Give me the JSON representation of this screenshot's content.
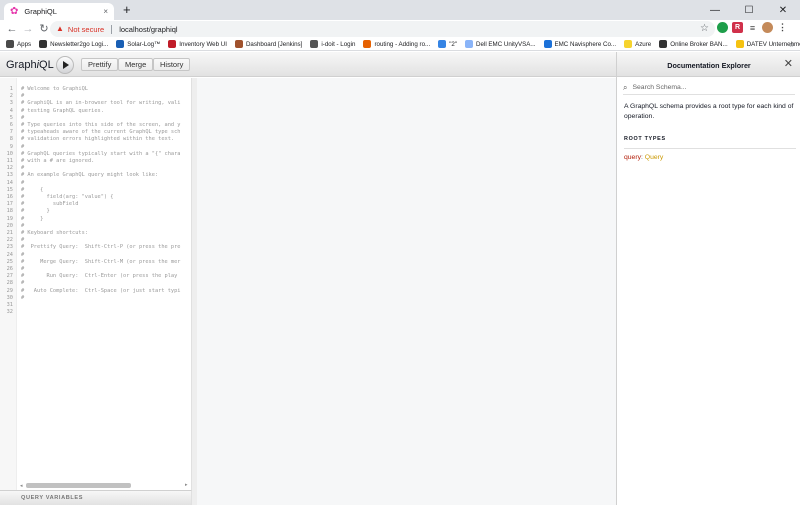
{
  "browser": {
    "tab_title": "GraphiQL",
    "tab_close": "×",
    "new_tab": "+",
    "window_controls": [
      "—",
      "☐",
      "✕"
    ],
    "nav": {
      "back": "←",
      "forward": "→",
      "reload": "↻"
    },
    "security_label": "Not secure",
    "url": "localhost/graphiql",
    "star_icon": "star-icon",
    "bookmarks": [
      {
        "label": "Apps",
        "color": "#4a4a4a"
      },
      {
        "label": "Newsletter2go Logi...",
        "color": "#333333"
      },
      {
        "label": "Solar-Log™",
        "color": "#1a5fb4"
      },
      {
        "label": "Inventory Web UI",
        "color": "#c01c28"
      },
      {
        "label": "Dashboard [Jenkins]",
        "color": "#a0522d"
      },
      {
        "label": "i-doit - Login",
        "color": "#555555"
      },
      {
        "label": "routing - Adding ro...",
        "color": "#e66100"
      },
      {
        "label": "\"2\"",
        "color": "#3584e4"
      },
      {
        "label": "Dell EMC UnityVSA...",
        "color": "#8ab4f8"
      },
      {
        "label": "EMC Navisphere Co...",
        "color": "#1c71d8"
      },
      {
        "label": "Azure",
        "color": "#f6d32d"
      },
      {
        "label": "Online Broker BAN...",
        "color": "#333333"
      },
      {
        "label": "DATEV Unternehme...",
        "color": "#f5c211"
      }
    ],
    "bookmarks_more": "»"
  },
  "graphiql": {
    "title_prefix": "Graph",
    "title_italic": "i",
    "title_suffix": "QL",
    "buttons": {
      "prettify": "Prettify",
      "merge": "Merge",
      "history": "History"
    },
    "editor_lines": [
      "# Welcome to GraphiQL",
      "#",
      "# GraphiQL is an in-browser tool for writing, vali",
      "# testing GraphQL queries.",
      "#",
      "# Type queries into this side of the screen, and y",
      "# typeaheads aware of the current GraphQL type sch",
      "# validation errors highlighted within the text.",
      "#",
      "# GraphQL queries typically start with a \"{\" chara",
      "# with a # are ignored.",
      "#",
      "# An example GraphQL query might look like:",
      "#",
      "#     {",
      "#       field(arg: \"value\") {",
      "#         subField",
      "#       }",
      "#     }",
      "#",
      "# Keyboard shortcuts:",
      "#",
      "#  Prettify Query:  Shift-Ctrl-P (or press the pre",
      "#",
      "#     Merge Query:  Shift-Ctrl-M (or press the mer",
      "#",
      "#       Run Query:  Ctrl-Enter (or press the play",
      "#",
      "#   Auto Complete:  Ctrl-Space (or just start typi",
      "#",
      "",
      ""
    ],
    "query_variables_label": "QUERY VARIABLES"
  },
  "doc_explorer": {
    "title": "Documentation Explorer",
    "close": "✕",
    "search_placeholder": "Search Schema...",
    "description": "A GraphQL schema provides a root type for each kind of operation.",
    "section_title": "ROOT TYPES",
    "root_types": [
      {
        "field": "query",
        "type": "Query"
      }
    ]
  }
}
